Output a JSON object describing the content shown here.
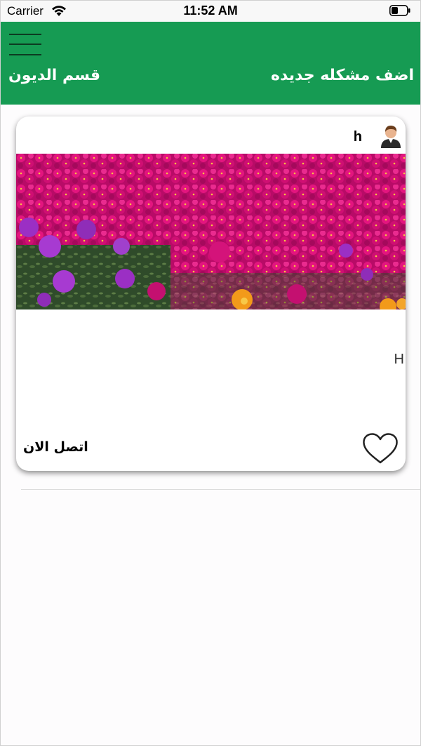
{
  "status_bar": {
    "carrier": "Carrier",
    "time": "11:52 AM"
  },
  "header": {
    "menu_icon": "hamburger-menu-icon",
    "left_title": "قسم الديون",
    "right_action": "اضف مشكله جديده",
    "background_color": "#169b53"
  },
  "post": {
    "user_name": "h",
    "avatar_icon": "user-avatar-icon",
    "image_subject": "pink-flowers-photo",
    "text": "H",
    "like_icon": "heart-icon",
    "contact_label": "اتصل الان"
  }
}
